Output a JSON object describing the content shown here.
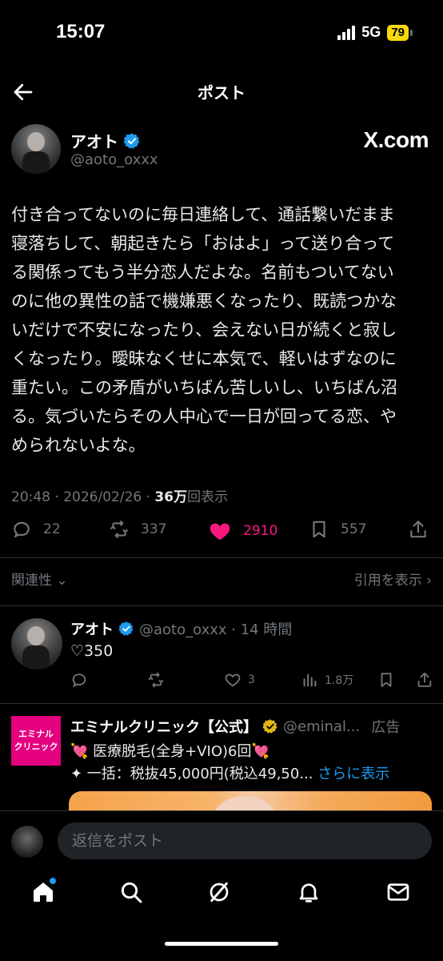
{
  "status_bar": {
    "time": "15:07",
    "network": "5G",
    "battery": "79"
  },
  "header": {
    "title": "ポスト"
  },
  "post": {
    "author_name": "アオト",
    "author_handle": "@aoto_oxxx",
    "source_label": "X.com",
    "lines": [
      "付き合ってないのに毎日連絡して、通話繋いだまま",
      "寝落ちして、朝起きたら「おはよ」って送り合って",
      "る関係ってもう半分恋人だよな。名前もついてない",
      "のに他の異性の話で機嫌悪くなったり、既読つかな",
      "いだけで不安になったり、会えない日が続くと寂し",
      "くなったり。曖昧なくせに本気で、軽いはずなのに",
      "重たい。この矛盾がいちばん苦しいし、いちばん沼",
      "る。気づいたらその人中心で一日が回ってる恋、や",
      "められないよな。"
    ],
    "time": "20:48",
    "date": "2026/02/26",
    "views_count": "36万",
    "views_label": "回表示",
    "replies": "22",
    "reposts": "337",
    "likes": "2910",
    "bookmarks": "557"
  },
  "sort": {
    "relevance_label": "関連性",
    "quotes_label": "引用を表示"
  },
  "reply": {
    "author_name": "アオト",
    "handle_time": "@aoto_oxxx · 14 時間",
    "text": "♡350",
    "likes": "3",
    "views": "1.8万"
  },
  "ad": {
    "logo_line1": "エミナル",
    "logo_line2": "クリニック",
    "name": "エミナルクリニック【公式】",
    "handle": "@eminal...",
    "ad_label": "広告",
    "line1": "💘 医療脱毛(全身+VIO)6回💘",
    "line2": "✦ 一括：税抜45,000円(税込49,50...",
    "more": "さらに表示"
  },
  "compose": {
    "placeholder": "返信をポスト"
  },
  "colors": {
    "accent": "#1d9bf0",
    "like": "#f91880",
    "muted": "#71767b",
    "ad_brand": "#e4007f"
  }
}
